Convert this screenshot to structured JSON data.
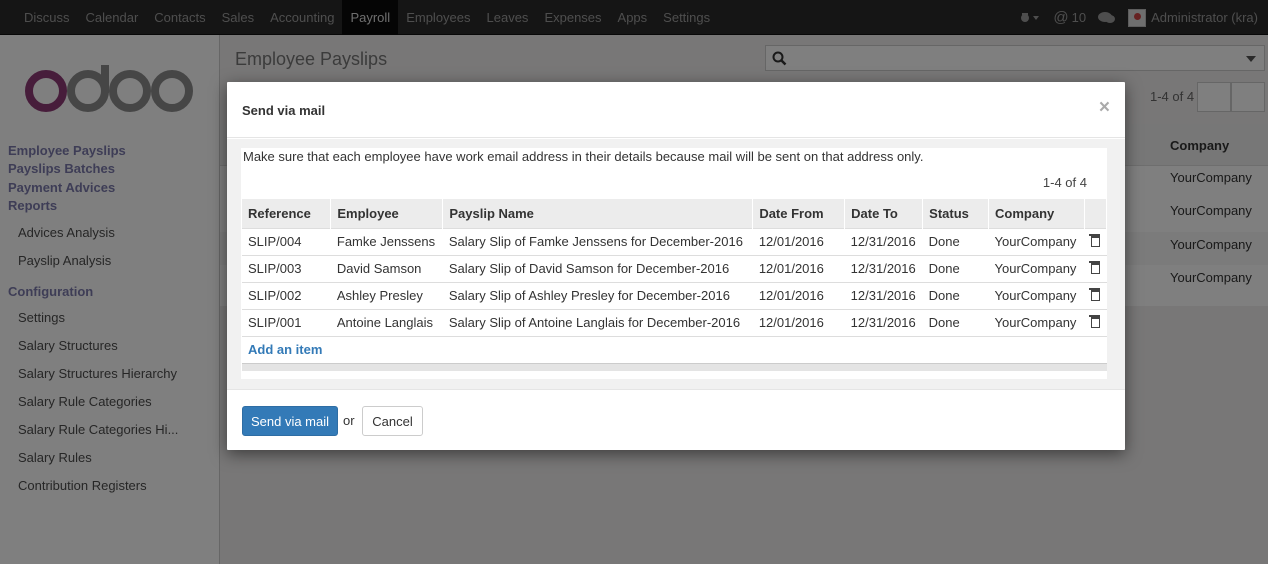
{
  "topbar": {
    "menu": [
      "Discuss",
      "Calendar",
      "Contacts",
      "Sales",
      "Accounting",
      "Payroll",
      "Employees",
      "Leaves",
      "Expenses",
      "Apps",
      "Settings"
    ],
    "active": "Payroll",
    "notifications": "10",
    "user": "Administrator (kra)"
  },
  "sidebar": {
    "heads": [
      "Employee Payslips",
      "Payslips Batches",
      "Payment Advices",
      "Reports"
    ],
    "reports_items": [
      "Advices Analysis",
      "Payslip Analysis"
    ],
    "config_head": "Configuration",
    "config_items": [
      "Settings",
      "Salary Structures",
      "Salary Structures Hierarchy",
      "Salary Rule Categories",
      "Salary Rule Categories Hi...",
      "Salary Rules",
      "Contribution Registers"
    ]
  },
  "main": {
    "title": "Employee Payslips",
    "pager": "1-4 of 4",
    "company_header": "Company",
    "companies": [
      "YourCompany",
      "YourCompany",
      "YourCompany",
      "YourCompany"
    ]
  },
  "modal": {
    "title": "Send via mail",
    "close": "×",
    "note": "Make sure that each employee have work email address in their details because mail will be sent on that address only.",
    "pager": "1-4 of 4",
    "columns": [
      "Reference",
      "Employee",
      "Payslip Name",
      "Date From",
      "Date To",
      "Status",
      "Company"
    ],
    "rows": [
      [
        "SLIP/004",
        "Famke Jenssens",
        "Salary Slip of Famke Jenssens for December-2016",
        "12/01/2016",
        "12/31/2016",
        "Done",
        "YourCompany"
      ],
      [
        "SLIP/003",
        "David Samson",
        "Salary Slip of David Samson for December-2016",
        "12/01/2016",
        "12/31/2016",
        "Done",
        "YourCompany"
      ],
      [
        "SLIP/002",
        "Ashley Presley",
        "Salary Slip of Ashley Presley for December-2016",
        "12/01/2016",
        "12/31/2016",
        "Done",
        "YourCompany"
      ],
      [
        "SLIP/001",
        "Antoine Langlais",
        "Salary Slip of Antoine Langlais for December-2016",
        "12/01/2016",
        "12/31/2016",
        "Done",
        "YourCompany"
      ]
    ],
    "add_item": "Add an item",
    "send_label": "Send via mail",
    "or": "or",
    "cancel_label": "Cancel"
  },
  "colors": {
    "brand": "#7c7bad",
    "primary": "#337ab7",
    "topbar": "#2a2a2a"
  }
}
